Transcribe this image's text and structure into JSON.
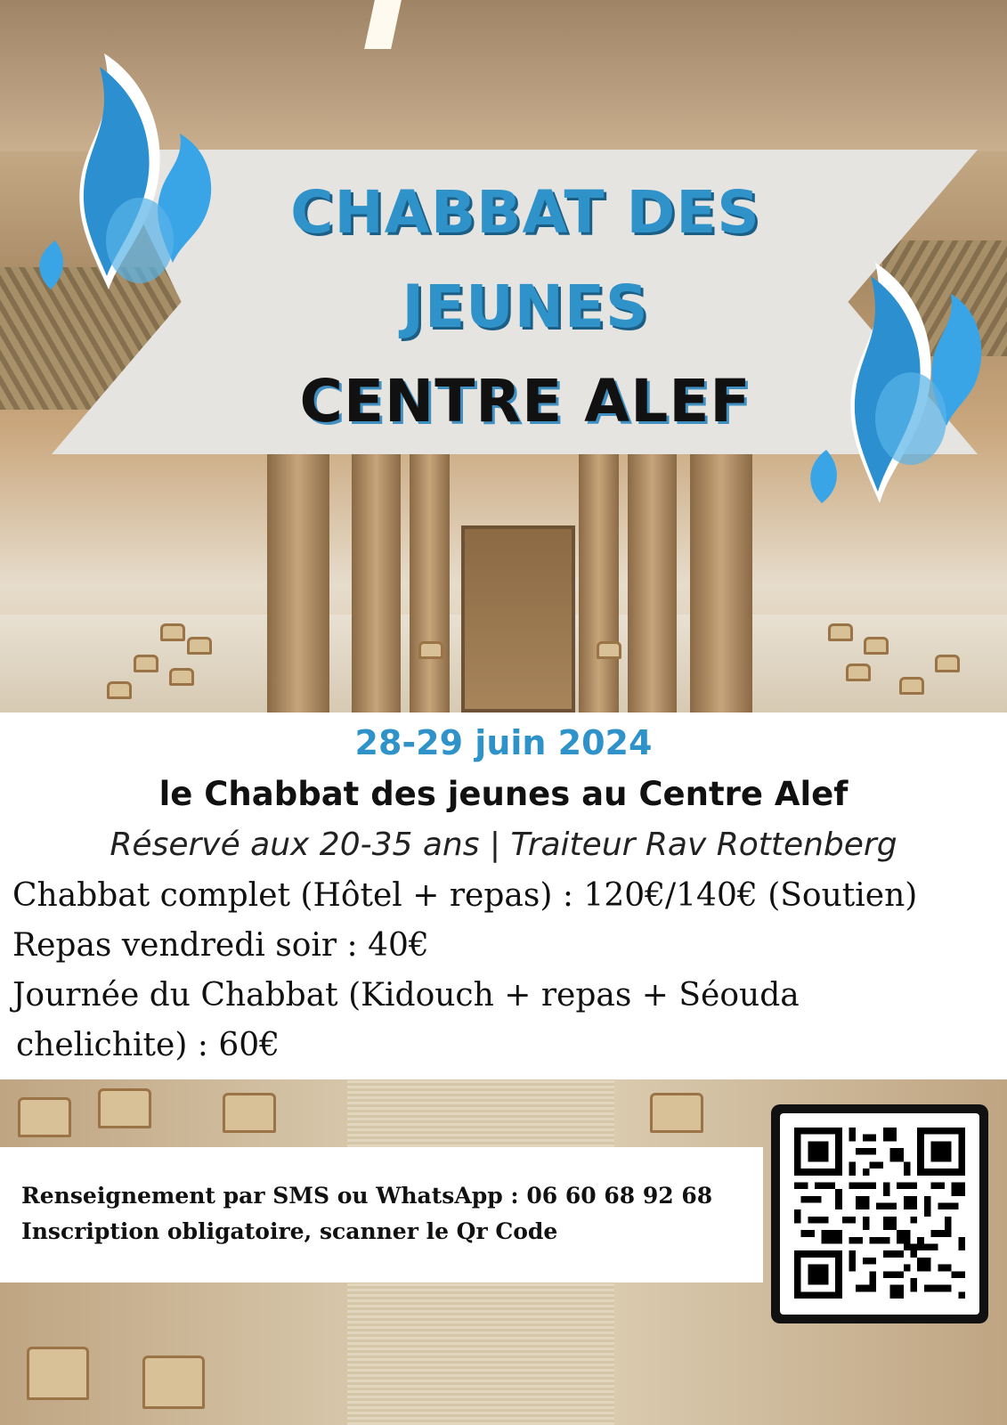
{
  "banner": {
    "title_line1": "CHABBAT DES",
    "title_line2": "JEUNES",
    "title_line3": "CENTRE ALEF"
  },
  "event": {
    "date": "28-29 juin 2024",
    "subtitle": "le Chabbat des jeunes au Centre Alef",
    "tagline": "Réservé aux 20-35 ans | Traiteur Rav Rottenberg"
  },
  "prices": [
    "Chabbat complet (Hôtel + repas) : 120€/140€ (Soutien)",
    "Repas vendredi soir : 40€",
    "Journée du Chabbat (Kidouch + repas + Séouda",
    "chelichite) : 60€"
  ],
  "contact": {
    "line1": "Renseignement par SMS ou WhatsApp : 06 60 68 92 68",
    "line2": "Inscription obligatoire, scanner le Qr Code"
  },
  "colors": {
    "accent_blue": "#2f92c9",
    "banner_grey": "#e5e4e1",
    "text_dark": "#111111"
  },
  "icons": [
    "flame-logo-icon",
    "qr-code-icon"
  ]
}
